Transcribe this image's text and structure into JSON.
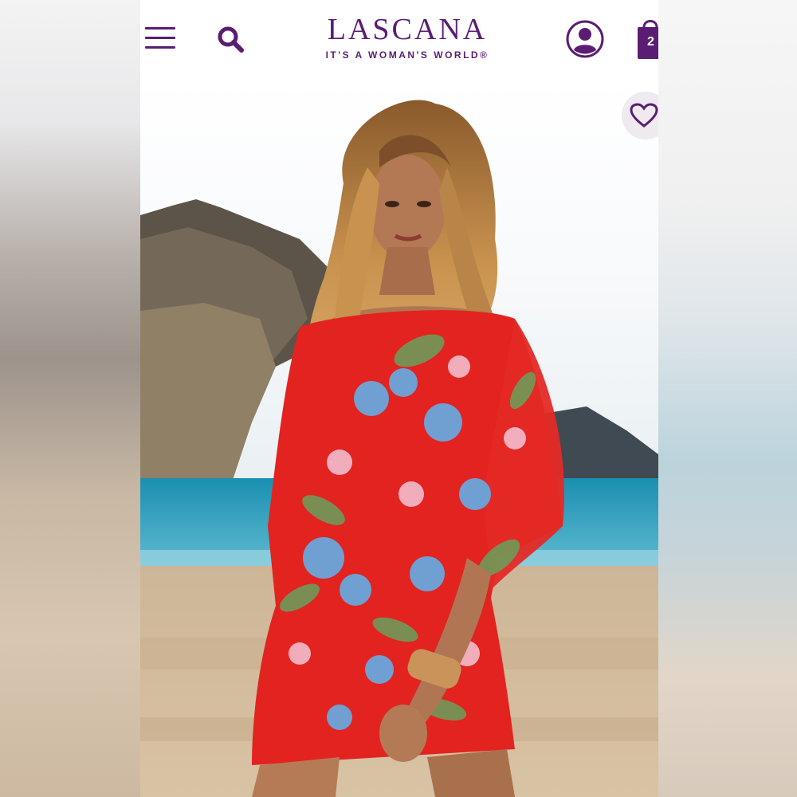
{
  "header": {
    "brand": "LASCANA",
    "tagline": "IT'S A WOMAN'S WORLD®",
    "cart_count": "2"
  },
  "icons": {
    "menu": "hamburger-menu-icon",
    "search": "search-icon",
    "account": "user-account-icon",
    "cart": "shopping-bag-icon",
    "favorite": "heart-icon"
  },
  "colors": {
    "brand": "#5a1d73",
    "favorite_bg": "#eeeaf0"
  },
  "product_image": {
    "subject": "model in red floral tropical-print beach dress"
  }
}
